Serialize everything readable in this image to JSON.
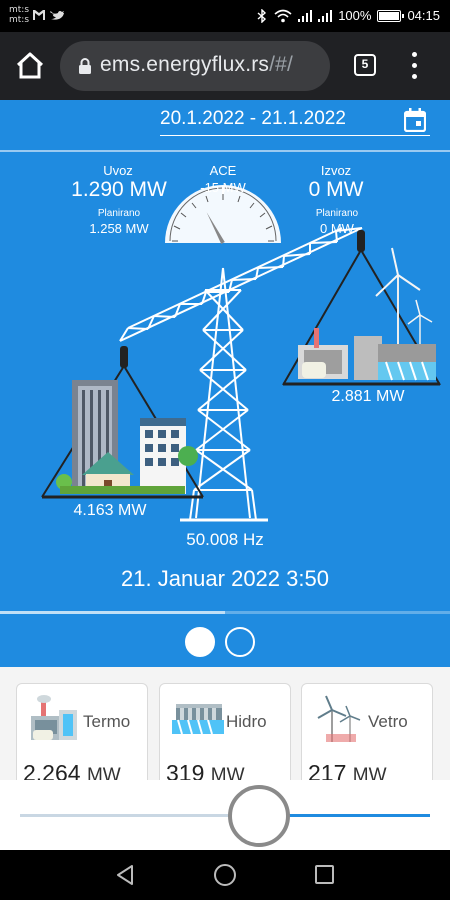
{
  "status_bar": {
    "carrier_top": "mt:s",
    "carrier_bottom": "mt:s",
    "battery": "100%",
    "time": "04:15"
  },
  "browser": {
    "url_main": "ems.energyflux.rs",
    "url_rest": "/#/",
    "tab_count": "5"
  },
  "header": {
    "date_range": "20.1.2022 - 21.1.2022"
  },
  "balance": {
    "import_label": "Uvoz",
    "import_value": "1.290 MW",
    "import_planned_label": "Planirano",
    "import_planned_value": "1.258 MW",
    "ace_label": "ACE",
    "ace_value": "-15 MW",
    "export_label": "Izvoz",
    "export_value": "0 MW",
    "export_planned_label": "Planirano",
    "export_planned_value": "0 MW",
    "consumption_value": "4.163 MW",
    "production_value": "2.881 MW",
    "frequency_value": "50.008 Hz",
    "gauge_needle_deg": 28
  },
  "timeline": {
    "datetime": "21. Januar 2022 3:50",
    "progress": 0.5
  },
  "pager": {
    "active_index": 0,
    "count": 2
  },
  "cards": [
    {
      "label": "Termo",
      "value": "2.264",
      "unit": "MW",
      "icon": "thermal-plant-icon"
    },
    {
      "label": "Hidro",
      "value": "319",
      "unit": "MW",
      "icon": "hydro-dam-icon"
    },
    {
      "label": "Vetro",
      "value": "217",
      "unit": "MW",
      "icon": "wind-turbine-icon"
    }
  ],
  "slider": {
    "position": 0.6
  },
  "colors": {
    "main_blue": "#1f8be0",
    "browser_dark": "#202124"
  }
}
